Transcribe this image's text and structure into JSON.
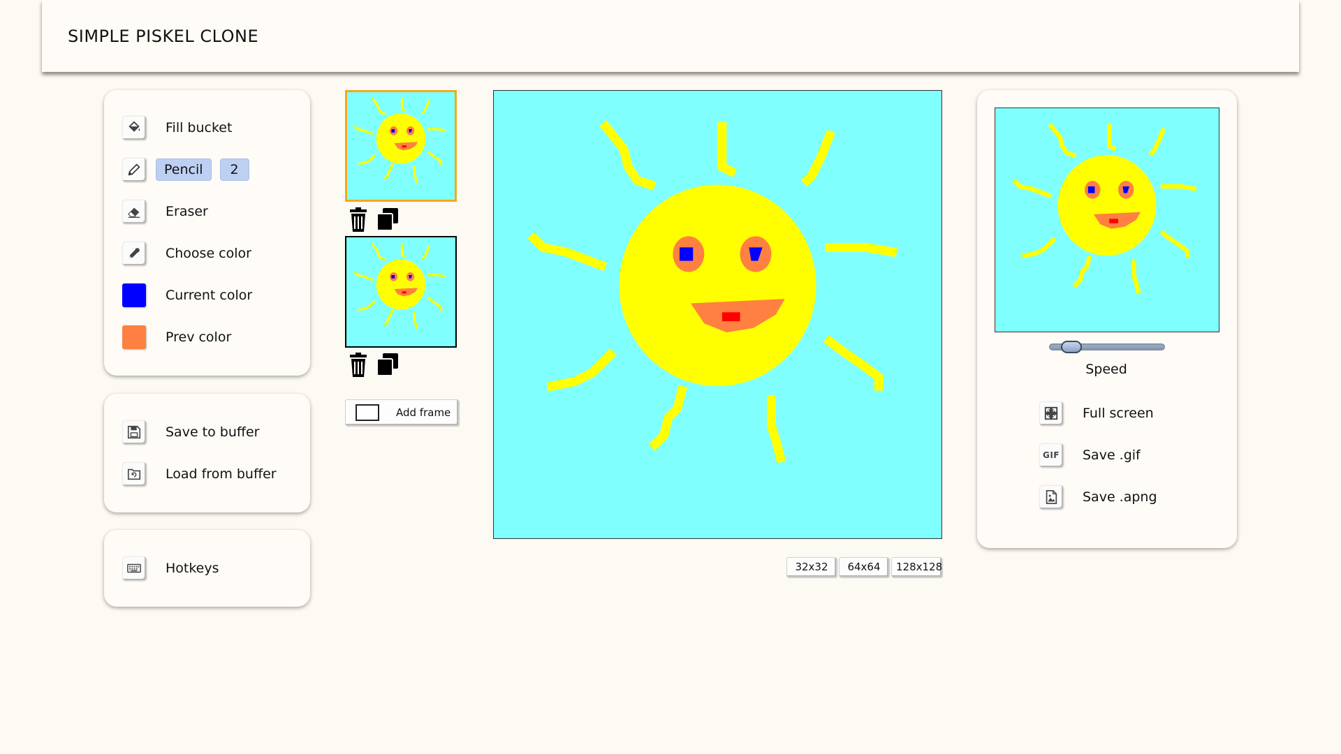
{
  "app": {
    "title": "SIMPLE PISKEL CLONE"
  },
  "tools": {
    "fill_bucket": "Fill bucket",
    "pencil": "Pencil",
    "pencil_size": "2",
    "eraser": "Eraser",
    "choose_color": "Choose color",
    "current_color_label": "Current color",
    "prev_color_label": "Prev color",
    "current_color": "#0000ff",
    "prev_color": "#ff8040"
  },
  "buffer": {
    "save": "Save to buffer",
    "load": "Load from buffer"
  },
  "help": {
    "hotkeys": "Hotkeys"
  },
  "frames": {
    "count": 2,
    "active_index": 0,
    "add_label": "Add frame"
  },
  "canvas": {
    "background_color": "#80ffff",
    "sizes": [
      "32x32",
      "64x64",
      "128x128"
    ]
  },
  "preview": {
    "speed_label": "Speed",
    "speed_value": 0.1,
    "full_screen": "Full screen",
    "save_gif": "Save .gif",
    "gif_icon_text": "GIF",
    "save_apng": "Save .apng"
  },
  "colors": {
    "accent_frame_border": "#f4a818",
    "sun_yellow": "#ffff00",
    "eye_orange": "#ff8040",
    "mouth_red": "#ff0000",
    "chip_blue": "#bed0f2"
  }
}
